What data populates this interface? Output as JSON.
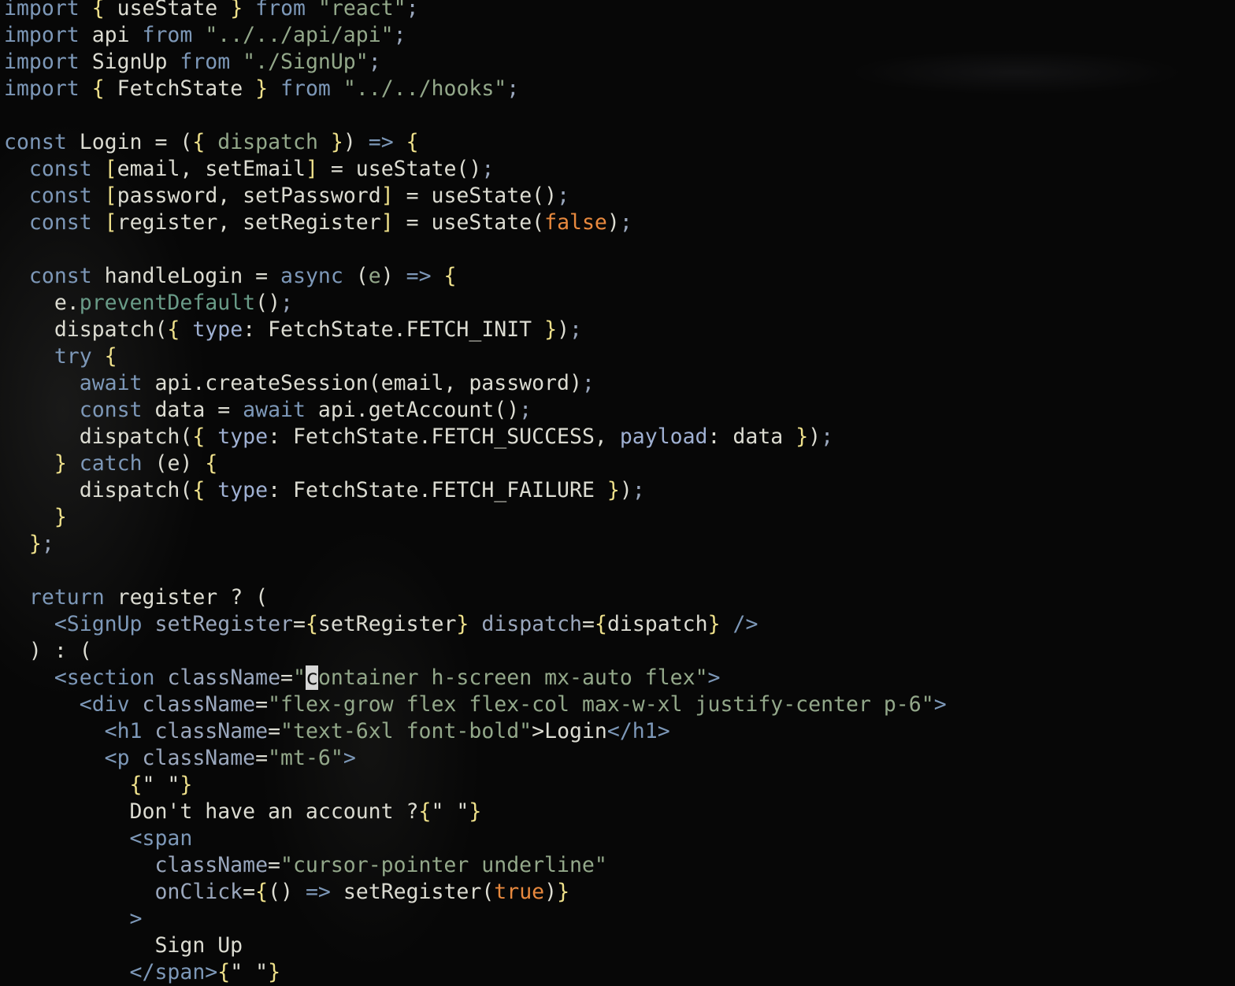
{
  "editor": {
    "lines": [
      [
        [
          "import",
          "k"
        ],
        [
          " ",
          ""
        ],
        [
          "{",
          "b"
        ],
        [
          " useState ",
          ""
        ],
        [
          "}",
          "b"
        ],
        [
          " ",
          ""
        ],
        [
          "from",
          "k"
        ],
        [
          " ",
          ""
        ],
        [
          "\"react\"",
          "s"
        ],
        [
          ";",
          "pu"
        ]
      ],
      [
        [
          "import",
          "k"
        ],
        [
          " api ",
          ""
        ],
        [
          "from",
          "k"
        ],
        [
          " ",
          ""
        ],
        [
          "\"../../api/api\"",
          "s"
        ],
        [
          ";",
          "pu"
        ]
      ],
      [
        [
          "import",
          "k"
        ],
        [
          " SignUp ",
          ""
        ],
        [
          "from",
          "k"
        ],
        [
          " ",
          ""
        ],
        [
          "\"./SignUp\"",
          "s"
        ],
        [
          ";",
          "pu"
        ]
      ],
      [
        [
          "import",
          "k"
        ],
        [
          " ",
          ""
        ],
        [
          "{",
          "b"
        ],
        [
          " FetchState ",
          ""
        ],
        [
          "}",
          "b"
        ],
        [
          " ",
          ""
        ],
        [
          "from",
          "k"
        ],
        [
          " ",
          ""
        ],
        [
          "\"../../hooks\"",
          "s"
        ],
        [
          ";",
          "pu"
        ]
      ],
      [],
      [
        [
          "const",
          "k"
        ],
        [
          " Login = (",
          ""
        ],
        [
          "{",
          "b"
        ],
        [
          " ",
          ""
        ],
        [
          "dispatch",
          "pn"
        ],
        [
          " ",
          ""
        ],
        [
          "}",
          "b"
        ],
        [
          ") ",
          ""
        ],
        [
          "=>",
          "k"
        ],
        [
          " ",
          ""
        ],
        [
          "{",
          "b"
        ]
      ],
      [
        [
          "  ",
          ""
        ],
        [
          "const",
          "k"
        ],
        [
          " ",
          ""
        ],
        [
          "[",
          "b"
        ],
        [
          "email, setEmail",
          ""
        ],
        [
          "]",
          "b"
        ],
        [
          " = useState()",
          ""
        ],
        [
          ";",
          "pu"
        ]
      ],
      [
        [
          "  ",
          ""
        ],
        [
          "const",
          "k"
        ],
        [
          " ",
          ""
        ],
        [
          "[",
          "b"
        ],
        [
          "password, setPassword",
          ""
        ],
        [
          "]",
          "b"
        ],
        [
          " = useState()",
          ""
        ],
        [
          ";",
          "pu"
        ]
      ],
      [
        [
          "  ",
          ""
        ],
        [
          "const",
          "k"
        ],
        [
          " ",
          ""
        ],
        [
          "[",
          "b"
        ],
        [
          "register, setRegister",
          ""
        ],
        [
          "]",
          "b"
        ],
        [
          " = useState(",
          ""
        ],
        [
          "false",
          "o"
        ],
        [
          ")",
          ""
        ],
        [
          ";",
          "pu"
        ]
      ],
      [],
      [
        [
          "  ",
          ""
        ],
        [
          "const",
          "k"
        ],
        [
          " handleLogin = ",
          ""
        ],
        [
          "async",
          "k"
        ],
        [
          " (",
          ""
        ],
        [
          "e",
          "pn"
        ],
        [
          ") ",
          ""
        ],
        [
          "=>",
          "k"
        ],
        [
          " ",
          ""
        ],
        [
          "{",
          "b"
        ]
      ],
      [
        [
          "    e.",
          ""
        ],
        [
          "preventDefault",
          "m"
        ],
        [
          "()",
          ""
        ],
        [
          ";",
          "pu"
        ]
      ],
      [
        [
          "    dispatch(",
          ""
        ],
        [
          "{",
          "b"
        ],
        [
          " ",
          ""
        ],
        [
          "type",
          "p"
        ],
        [
          ": FetchState.FETCH_INIT ",
          ""
        ],
        [
          "}",
          "b"
        ],
        [
          ")",
          ""
        ],
        [
          ";",
          "pu"
        ]
      ],
      [
        [
          "    ",
          ""
        ],
        [
          "try",
          "k"
        ],
        [
          " ",
          ""
        ],
        [
          "{",
          "b"
        ]
      ],
      [
        [
          "      ",
          ""
        ],
        [
          "await",
          "k"
        ],
        [
          " api.createSession(email, password)",
          ""
        ],
        [
          ";",
          "pu"
        ]
      ],
      [
        [
          "      ",
          ""
        ],
        [
          "const",
          "k"
        ],
        [
          " data = ",
          ""
        ],
        [
          "await",
          "k"
        ],
        [
          " api.getAccount()",
          ""
        ],
        [
          ";",
          "pu"
        ]
      ],
      [
        [
          "      dispatch(",
          ""
        ],
        [
          "{",
          "b"
        ],
        [
          " ",
          ""
        ],
        [
          "type",
          "p"
        ],
        [
          ": FetchState.FETCH_SUCCESS, ",
          ""
        ],
        [
          "payload",
          "p"
        ],
        [
          ": data ",
          ""
        ],
        [
          "}",
          "b"
        ],
        [
          ")",
          ""
        ],
        [
          ";",
          "pu"
        ]
      ],
      [
        [
          "    ",
          ""
        ],
        [
          "}",
          "b"
        ],
        [
          " ",
          ""
        ],
        [
          "catch",
          "k"
        ],
        [
          " (e) ",
          ""
        ],
        [
          "{",
          "b"
        ]
      ],
      [
        [
          "      dispatch(",
          ""
        ],
        [
          "{",
          "b"
        ],
        [
          " ",
          ""
        ],
        [
          "type",
          "p"
        ],
        [
          ": FetchState.FETCH_FAILURE ",
          ""
        ],
        [
          "}",
          "b"
        ],
        [
          ")",
          ""
        ],
        [
          ";",
          "pu"
        ]
      ],
      [
        [
          "    ",
          ""
        ],
        [
          "}",
          "b"
        ]
      ],
      [
        [
          "  ",
          ""
        ],
        [
          "}",
          "b"
        ],
        [
          ";",
          "pu"
        ]
      ],
      [],
      [
        [
          "  ",
          ""
        ],
        [
          "return",
          "k"
        ],
        [
          " register ? (",
          ""
        ]
      ],
      [
        [
          "    ",
          ""
        ],
        [
          "<SignUp",
          "t"
        ],
        [
          " ",
          ""
        ],
        [
          "setRegister",
          "a"
        ],
        [
          "=",
          ""
        ],
        [
          "{",
          "b"
        ],
        [
          "setRegister",
          ""
        ],
        [
          "}",
          "b"
        ],
        [
          " ",
          ""
        ],
        [
          "dispatch",
          "a"
        ],
        [
          "=",
          ""
        ],
        [
          "{",
          "b"
        ],
        [
          "dispatch",
          ""
        ],
        [
          "}",
          "b"
        ],
        [
          " ",
          ""
        ],
        [
          "/>",
          "t"
        ]
      ],
      [
        [
          "  ) : (",
          ""
        ]
      ],
      [
        [
          "    ",
          ""
        ],
        [
          "<section",
          "t"
        ],
        [
          " ",
          ""
        ],
        [
          "className",
          "a"
        ],
        [
          "=",
          ""
        ],
        [
          "\"",
          "s"
        ],
        [
          "c",
          "cursor"
        ],
        [
          "ontainer h-screen mx-auto flex\"",
          "s"
        ],
        [
          ">",
          "t"
        ]
      ],
      [
        [
          "      ",
          ""
        ],
        [
          "<div",
          "t"
        ],
        [
          " ",
          ""
        ],
        [
          "className",
          "a"
        ],
        [
          "=",
          ""
        ],
        [
          "\"flex-grow flex flex-col max-w-xl justify-center p-6\"",
          "s"
        ],
        [
          ">",
          "t"
        ]
      ],
      [
        [
          "        ",
          ""
        ],
        [
          "<h1",
          "t"
        ],
        [
          " ",
          ""
        ],
        [
          "className",
          "a"
        ],
        [
          "=",
          ""
        ],
        [
          "\"text-6xl font-bold\"",
          "s"
        ],
        [
          ">",
          ""
        ],
        [
          "Login",
          ""
        ],
        [
          "</h1>",
          "t"
        ]
      ],
      [
        [
          "        ",
          ""
        ],
        [
          "<p",
          "t"
        ],
        [
          " ",
          ""
        ],
        [
          "className",
          "a"
        ],
        [
          "=",
          ""
        ],
        [
          "\"mt-6\"",
          "s"
        ],
        [
          ">",
          "t"
        ]
      ],
      [
        [
          "          ",
          ""
        ],
        [
          "{",
          "b"
        ],
        [
          "\" \"",
          ""
        ],
        [
          "}",
          "b"
        ]
      ],
      [
        [
          "          Don't have an account ?",
          ""
        ],
        [
          "{",
          "b"
        ],
        [
          "\" \"",
          ""
        ],
        [
          "}",
          "b"
        ]
      ],
      [
        [
          "          ",
          ""
        ],
        [
          "<span",
          "t"
        ]
      ],
      [
        [
          "            ",
          ""
        ],
        [
          "className",
          "a"
        ],
        [
          "=",
          ""
        ],
        [
          "\"cursor-pointer underline\"",
          "s"
        ]
      ],
      [
        [
          "            ",
          ""
        ],
        [
          "onClick",
          "a"
        ],
        [
          "=",
          ""
        ],
        [
          "{",
          "b"
        ],
        [
          "() ",
          ""
        ],
        [
          "=>",
          "k"
        ],
        [
          " setRegister(",
          ""
        ],
        [
          "true",
          "o"
        ],
        [
          ")",
          ""
        ],
        [
          "}",
          "b"
        ]
      ],
      [
        [
          "          ",
          ""
        ],
        [
          ">",
          "t"
        ]
      ],
      [
        [
          "            Sign Up",
          ""
        ]
      ],
      [
        [
          "          ",
          ""
        ],
        [
          "</span>",
          "t"
        ],
        [
          "{",
          "b"
        ],
        [
          "\" \"",
          ""
        ],
        [
          "}",
          "b"
        ]
      ]
    ]
  }
}
